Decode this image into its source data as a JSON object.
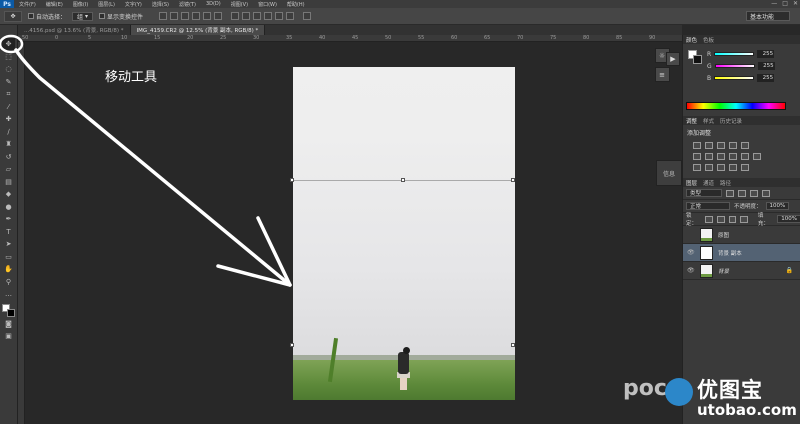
{
  "app": {
    "logo": "Ps"
  },
  "menubar": {
    "items": [
      "文件(F)",
      "编辑(E)",
      "图像(I)",
      "图层(L)",
      "文字(Y)",
      "选择(S)",
      "滤镜(T)",
      "3D(D)",
      "视图(V)",
      "窗口(W)",
      "帮助(H)"
    ],
    "window_controls": [
      "—",
      "□",
      "✕"
    ]
  },
  "options_bar": {
    "tool_icon": "move-icon",
    "auto_select_label": "自动选择：",
    "auto_select_value": "组",
    "show_transform_label": "显示变换控件",
    "workspace": "基本功能"
  },
  "tabs": [
    {
      "label": "...4156.psd @ 13.6% (背景, RGB/8) *",
      "active": false
    },
    {
      "label": "IMG_4159.CR2 @ 12.5% (背景 副本, RGB/8) *",
      "active": true
    }
  ],
  "ruler_ticks": [
    "50",
    "0",
    "5",
    "10",
    "15",
    "20",
    "25",
    "30",
    "35",
    "40",
    "45",
    "50",
    "55",
    "60",
    "65",
    "70",
    "75",
    "80",
    "85",
    "90"
  ],
  "annotation": {
    "text": "移动工具"
  },
  "color_panel": {
    "tabs": [
      "颜色",
      "色板"
    ],
    "sliders": [
      {
        "label": "R",
        "value": "255",
        "gradient": "linear-gradient(90deg,#00ffff,#ffffff)"
      },
      {
        "label": "G",
        "value": "255",
        "gradient": "linear-gradient(90deg,#ff00ff,#ffffff)"
      },
      {
        "label": "B",
        "value": "255",
        "gradient": "linear-gradient(90deg,#ffff00,#ffffff)"
      }
    ]
  },
  "adjust_panel": {
    "tabs": [
      "调整",
      "样式",
      "历史记录"
    ],
    "title": "添加调整"
  },
  "layers_panel": {
    "tabs": [
      "图层",
      "通道",
      "路径"
    ],
    "filter": "类型",
    "blend_mode": "正常",
    "opacity_label": "不透明度：",
    "opacity_value": "100%",
    "lock_label": "锁定：",
    "fill_label": "填充：",
    "fill_value": "100%",
    "layers": [
      {
        "name": "原图",
        "visible": false,
        "selected": false,
        "thumb": "photo"
      },
      {
        "name": "背景 副本",
        "visible": true,
        "selected": true,
        "thumb": "blank"
      },
      {
        "name": "背景",
        "visible": true,
        "selected": false,
        "thumb": "photo",
        "locked": true
      }
    ]
  },
  "side_tab": {
    "label": "信息"
  },
  "watermark": {
    "poco": "poco",
    "cn": "优图宝",
    "url": "utobao.com"
  }
}
